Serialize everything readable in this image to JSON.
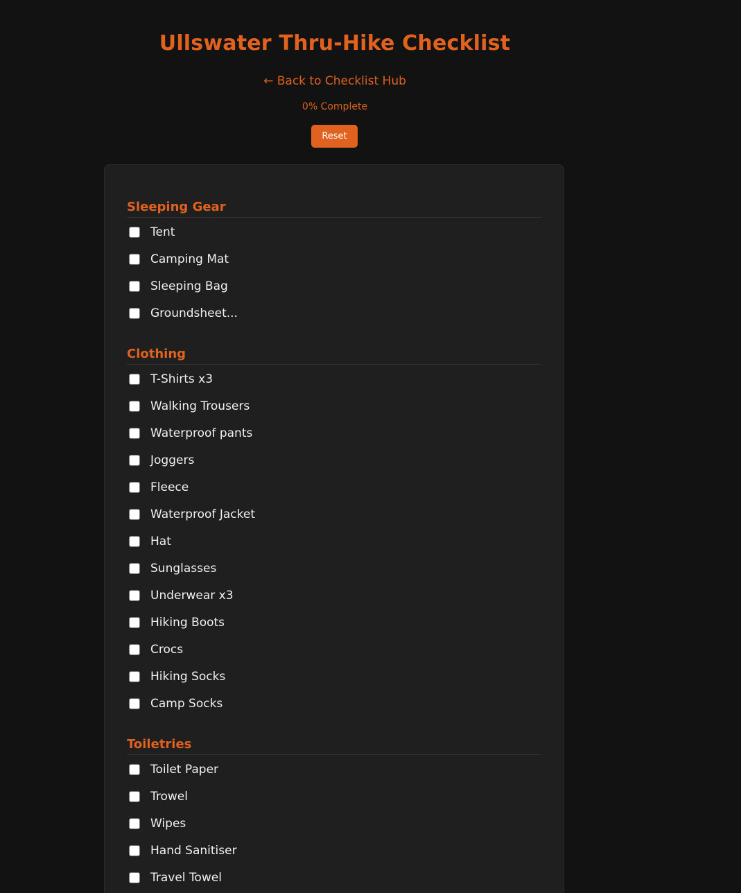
{
  "header": {
    "title": "Ullswater Thru-Hike Checklist",
    "back_link": "← Back to Checklist Hub",
    "progress_text": "0% Complete",
    "reset_label": "Reset"
  },
  "colors": {
    "accent": "#e0621e",
    "background": "#121212",
    "card": "#1f1f1f",
    "text": "#f0f0f0"
  },
  "progress": {
    "percent": 0
  },
  "sections": [
    {
      "title": "Sleeping Gear",
      "items": [
        {
          "label": "Tent",
          "checked": false
        },
        {
          "label": "Camping Mat",
          "checked": false
        },
        {
          "label": "Sleeping Bag",
          "checked": false
        },
        {
          "label": "Groundsheet...",
          "checked": false
        }
      ]
    },
    {
      "title": "Clothing",
      "items": [
        {
          "label": "T-Shirts x3",
          "checked": false
        },
        {
          "label": "Walking Trousers",
          "checked": false
        },
        {
          "label": "Waterproof pants",
          "checked": false
        },
        {
          "label": "Joggers",
          "checked": false
        },
        {
          "label": "Fleece",
          "checked": false
        },
        {
          "label": "Waterproof Jacket",
          "checked": false
        },
        {
          "label": "Hat",
          "checked": false
        },
        {
          "label": "Sunglasses",
          "checked": false
        },
        {
          "label": "Underwear x3",
          "checked": false
        },
        {
          "label": "Hiking Boots",
          "checked": false
        },
        {
          "label": "Crocs",
          "checked": false
        },
        {
          "label": "Hiking Socks",
          "checked": false
        },
        {
          "label": "Camp Socks",
          "checked": false
        }
      ]
    },
    {
      "title": "Toiletries",
      "items": [
        {
          "label": "Toilet Paper",
          "checked": false
        },
        {
          "label": "Trowel",
          "checked": false
        },
        {
          "label": "Wipes",
          "checked": false
        },
        {
          "label": "Hand Sanitiser",
          "checked": false
        },
        {
          "label": "Travel Towel",
          "checked": false
        }
      ]
    }
  ]
}
